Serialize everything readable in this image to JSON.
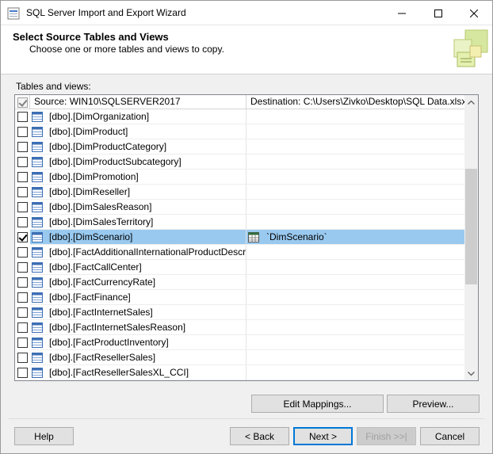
{
  "window": {
    "title": "SQL Server Import and Export Wizard"
  },
  "header": {
    "title": "Select Source Tables and Views",
    "subtitle": "Choose one or more tables and views to copy."
  },
  "group_label": "Tables and views:",
  "grid": {
    "source_header": "Source: WIN10\\SQLSERVER2017",
    "destination_header": "Destination: C:\\Users\\Zivko\\Desktop\\SQL Data.xlsx",
    "rows": [
      {
        "source": "[dbo].[DimOrganization]",
        "destination": "",
        "checked": false,
        "selected": false
      },
      {
        "source": "[dbo].[DimProduct]",
        "destination": "",
        "checked": false,
        "selected": false
      },
      {
        "source": "[dbo].[DimProductCategory]",
        "destination": "",
        "checked": false,
        "selected": false
      },
      {
        "source": "[dbo].[DimProductSubcategory]",
        "destination": "",
        "checked": false,
        "selected": false
      },
      {
        "source": "[dbo].[DimPromotion]",
        "destination": "",
        "checked": false,
        "selected": false
      },
      {
        "source": "[dbo].[DimReseller]",
        "destination": "",
        "checked": false,
        "selected": false
      },
      {
        "source": "[dbo].[DimSalesReason]",
        "destination": "",
        "checked": false,
        "selected": false
      },
      {
        "source": "[dbo].[DimSalesTerritory]",
        "destination": "",
        "checked": false,
        "selected": false
      },
      {
        "source": "[dbo].[DimScenario]",
        "destination": "`DimScenario`",
        "checked": true,
        "selected": true
      },
      {
        "source": "[dbo].[FactAdditionalInternationalProductDescrip...",
        "destination": "",
        "checked": false,
        "selected": false
      },
      {
        "source": "[dbo].[FactCallCenter]",
        "destination": "",
        "checked": false,
        "selected": false
      },
      {
        "source": "[dbo].[FactCurrencyRate]",
        "destination": "",
        "checked": false,
        "selected": false
      },
      {
        "source": "[dbo].[FactFinance]",
        "destination": "",
        "checked": false,
        "selected": false
      },
      {
        "source": "[dbo].[FactInternetSales]",
        "destination": "",
        "checked": false,
        "selected": false
      },
      {
        "source": "[dbo].[FactInternetSalesReason]",
        "destination": "",
        "checked": false,
        "selected": false
      },
      {
        "source": "[dbo].[FactProductInventory]",
        "destination": "",
        "checked": false,
        "selected": false
      },
      {
        "source": "[dbo].[FactResellerSales]",
        "destination": "",
        "checked": false,
        "selected": false
      },
      {
        "source": "[dbo].[FactResellerSalesXL_CCI]",
        "destination": "",
        "checked": false,
        "selected": false
      }
    ]
  },
  "buttons": {
    "edit_mappings": "Edit Mappings...",
    "preview": "Preview...",
    "help": "Help",
    "back": "< Back",
    "next": "Next >",
    "finish": "Finish >>|",
    "cancel": "Cancel"
  },
  "colors": {
    "selection": "#99c9ef",
    "default_button_border": "#0078d7"
  }
}
